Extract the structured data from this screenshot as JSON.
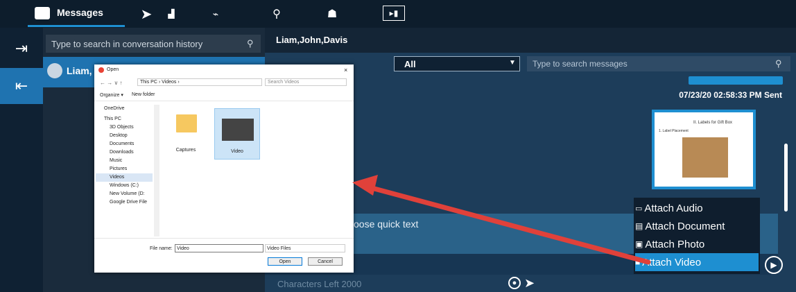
{
  "topnav": {
    "messages_label": "Messages",
    "icons": [
      "send-icon",
      "tile-icon",
      "route-icon",
      "pin-icon",
      "group-icon",
      "media-icon"
    ]
  },
  "convsearch": {
    "placeholder": "Type to search in conversation history"
  },
  "conversation": {
    "name": "Liam,"
  },
  "chat": {
    "title": "Liam,John,Davis",
    "filter": "All",
    "search_placeholder": "Type to search messages",
    "timestamp": "07/23/20 02:58:33 PM Sent",
    "image_caption": "II. Labels for Gift Box",
    "image_sub": "1. Label Placement",
    "quick_text": "oose quick text",
    "chars_left": "Characters Left 2000"
  },
  "attach_menu": {
    "items": [
      {
        "label": "Attach Audio",
        "icon": "audio-icon"
      },
      {
        "label": "Attach Document",
        "icon": "document-icon"
      },
      {
        "label": "Attach Photo",
        "icon": "photo-icon"
      },
      {
        "label": "Attach Video",
        "icon": "video-icon"
      }
    ],
    "selected": "Attach Video"
  },
  "dialog": {
    "title": "Open",
    "close": "×",
    "path": [
      "This PC",
      "Videos"
    ],
    "search_placeholder": "Search Videos",
    "organize": "Organize ▾",
    "new_folder": "New folder",
    "nav": [
      "OneDrive",
      "This PC",
      "3D Objects",
      "Desktop",
      "Documents",
      "Downloads",
      "Music",
      "Pictures",
      "Videos",
      "Windows (C:)",
      "New Volume (D:",
      "Google Drive File"
    ],
    "files": [
      {
        "name": "Captures"
      },
      {
        "name": "Video"
      }
    ],
    "filename_label": "File name:",
    "filename_value": "Video",
    "filetype": "Video Files",
    "open_button": "Open",
    "cancel_button": "Cancel"
  },
  "colors": {
    "accent": "#1e8fd1",
    "annotation_arrow": "#e0413a"
  }
}
